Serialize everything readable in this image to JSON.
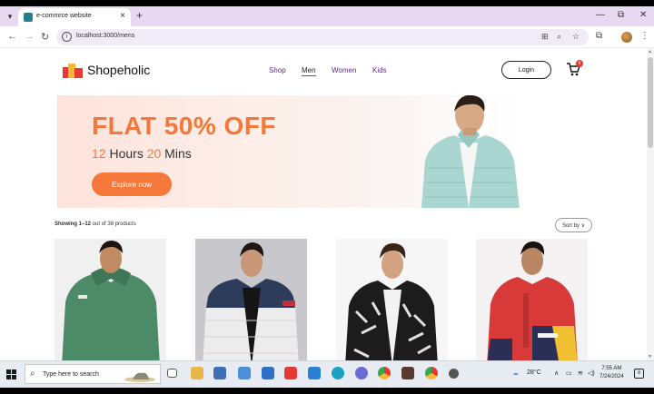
{
  "browser": {
    "tab_title": "e-commrce website",
    "tab_close": "×",
    "new_tab": "+",
    "url": "localhost:3000/mens",
    "window_controls": [
      "—",
      "⧉",
      "✕"
    ]
  },
  "site": {
    "brand": "Shopeholic",
    "nav": [
      "Shop",
      "Men",
      "Women",
      "Kids"
    ],
    "active_nav": "Men",
    "login_label": "Login",
    "cart_count": "0"
  },
  "banner": {
    "headline": "FLAT 50% OFF",
    "hours": "12",
    "hours_label": " Hours ",
    "mins": "20",
    "mins_label": " Mins",
    "button": "Explore now"
  },
  "listing": {
    "showing_prefix": "Showing 1–12",
    "showing_suffix": " out of 38 products",
    "sort_label": "Sort by ∨"
  },
  "products": [
    {
      "name": "green-hoodie",
      "bg": "#f0f0f0",
      "color": "#4d8a68"
    },
    {
      "name": "white-navy-red-puffer-jacket",
      "bg": "#c8c8cc",
      "color": "#ececec"
    },
    {
      "name": "black-white-printed-jacket",
      "bg": "#f6f6f6",
      "color": "#1c1c1c"
    },
    {
      "name": "red-navy-yellow-windcheater",
      "bg": "#f4f2f2",
      "color": "#d83a3a"
    }
  ],
  "taskbar": {
    "search_placeholder": "Type here to search",
    "temperature": "28°C",
    "time": "7:55 AM",
    "date": "7/24/2024"
  },
  "colors": {
    "accent": "#f5783a",
    "nav_purple": "#5a2d82",
    "tab_strip": "#e8d9f3"
  }
}
